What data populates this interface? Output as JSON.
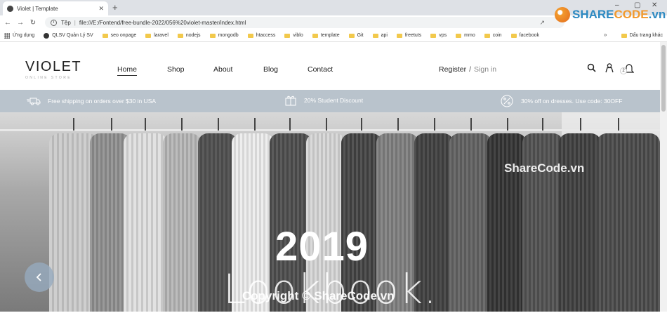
{
  "browser": {
    "tab_title": "Violet | Template",
    "address_prefix": "Tệp",
    "url": "file:///E:/Fontend/free-bundle-2022/056%20violet-master/index.html",
    "bookmarks": [
      "Ứng dụng",
      "QLSV Quản Lý SV",
      "seo onpage",
      "laravel",
      "nodejs",
      "mongodb",
      "htaccess",
      "viblo",
      "template",
      "Git",
      "api",
      "freetuts",
      "vps",
      "mmo",
      "coin",
      "facebook"
    ],
    "bookmarks_more": "»",
    "bookmarks_other": "Dấu trang khác"
  },
  "site": {
    "logo": "VIOLET",
    "logo_sub": "ONLINE STORE",
    "nav": [
      "Home",
      "Shop",
      "About",
      "Blog",
      "Contact"
    ],
    "register": "Register",
    "slash": "/",
    "sign_in": "Sign in",
    "cart_count": "2"
  },
  "promo": {
    "shipping": "Free shipping on orders over $30 in USA",
    "student": "20% Student Discount",
    "dresses": "30% off on dresses. Use code: 30OFF"
  },
  "hero": {
    "year": "2019",
    "subtitle": "Lookbook."
  },
  "watermarks": {
    "logo_a": "SHARE",
    "logo_b": "CODE",
    "logo_c": ".vn",
    "middle": "ShareCode.vn",
    "bottom": "Copyright © ShareCode.vn"
  },
  "colors": {
    "promo_bar": "#b9c3cc",
    "accent": "#2d8ac2"
  }
}
